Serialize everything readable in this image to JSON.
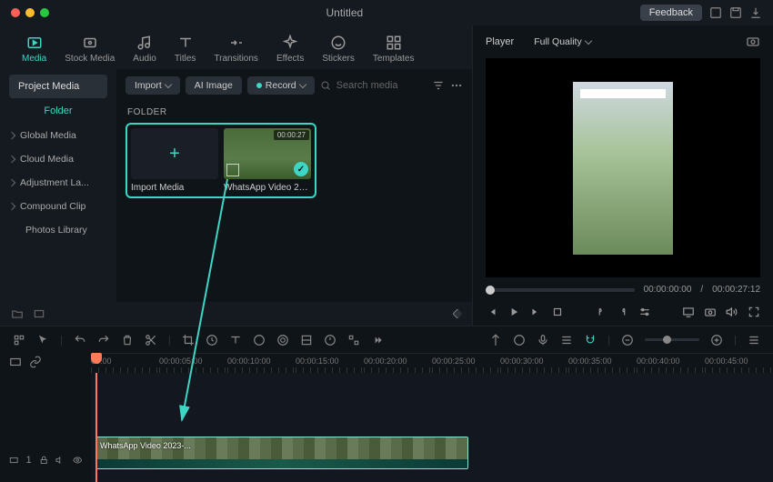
{
  "titlebar": {
    "title": "Untitled",
    "feedback": "Feedback"
  },
  "tabs": [
    {
      "label": "Media",
      "icon": "media-icon"
    },
    {
      "label": "Stock Media",
      "icon": "stock-icon"
    },
    {
      "label": "Audio",
      "icon": "audio-icon"
    },
    {
      "label": "Titles",
      "icon": "titles-icon"
    },
    {
      "label": "Transitions",
      "icon": "transitions-icon"
    },
    {
      "label": "Effects",
      "icon": "effects-icon"
    },
    {
      "label": "Stickers",
      "icon": "stickers-icon"
    },
    {
      "label": "Templates",
      "icon": "templates-icon"
    }
  ],
  "sidebar": {
    "header": "Project Media",
    "folder_label": "Folder",
    "items": [
      {
        "label": "Global Media"
      },
      {
        "label": "Cloud Media"
      },
      {
        "label": "Adjustment La..."
      },
      {
        "label": "Compound Clip"
      },
      {
        "label": "Photos Library"
      }
    ]
  },
  "toolbar": {
    "import": "Import",
    "ai_image": "AI Image",
    "record": "Record",
    "search_placeholder": "Search media"
  },
  "folder_section": "FOLDER",
  "thumbnails": [
    {
      "label": "Import Media",
      "type": "import"
    },
    {
      "label": "WhatsApp Video 202...",
      "type": "media",
      "duration": "00:00:27"
    }
  ],
  "player": {
    "label": "Player",
    "quality": "Full Quality",
    "current_time": "00:00:00:00",
    "total_time": "00:00:27:12",
    "separator": "/"
  },
  "ruler": [
    "00:00",
    "00:00:05:00",
    "00:00:10:00",
    "00:00:15:00",
    "00:00:20:00",
    "00:00:25:00",
    "00:00:30:00",
    "00:00:35:00",
    "00:00:40:00",
    "00:00:45:00"
  ],
  "track": {
    "num": "1"
  },
  "clip": {
    "label": "WhatsApp Video 2023-..."
  }
}
